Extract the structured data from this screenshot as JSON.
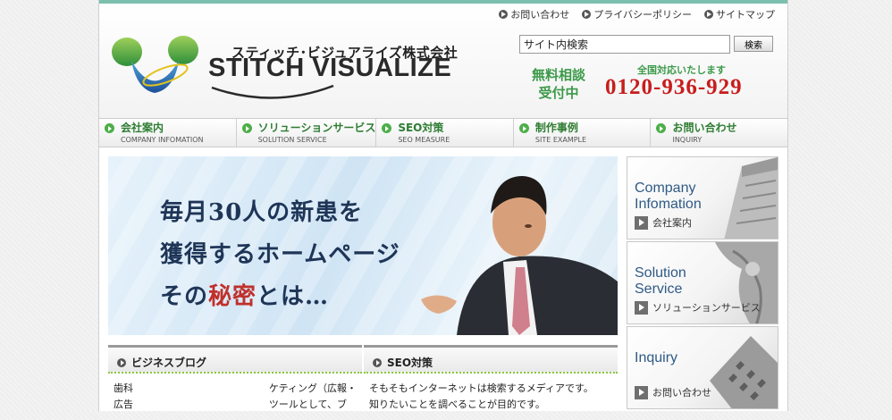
{
  "utility": [
    {
      "label": "お問い合わせ",
      "icon": "arrow-circle-icon"
    },
    {
      "label": "プライバシーポリシー",
      "icon": "arrow-circle-icon"
    },
    {
      "label": "サイトマップ",
      "icon": "arrow-circle-icon"
    }
  ],
  "brand": {
    "name_ja": "スティッチ･ビジュアライズ株式会社",
    "name_en": "STITCH VISUALIZE"
  },
  "search": {
    "value": "サイト内検索",
    "button_label": "検索"
  },
  "contact": {
    "consult_line1": "無料相談",
    "consult_line2": "受付中",
    "nationwide": "全国対応いたします",
    "phone": "0120-936-929"
  },
  "nav": [
    {
      "ja": "会社案内",
      "en": "COMPANY INFOMATION"
    },
    {
      "ja": "ソリューションサービス",
      "en": "SOLUTION SERVICE"
    },
    {
      "ja": "SEO対策",
      "en": "SEO MEASURE"
    },
    {
      "ja": "制作事例",
      "en": "SITE EXAMPLE"
    },
    {
      "ja": "お問い合わせ",
      "en": "INQUIRY"
    }
  ],
  "hero": {
    "line1": "毎月30人の新患を",
    "line2": "獲得するホームページ",
    "line3_prefix": "その",
    "line3_red": "秘密",
    "line3_suffix": "とは…"
  },
  "blog": {
    "title": "ビジネスブログ",
    "left_lines": [
      "歯科",
      "広告"
    ],
    "right_lines": [
      "ケティング（広報・",
      "ツールとして、ブ"
    ]
  },
  "seo": {
    "title": "SEO対策",
    "lines": [
      "そもそもインターネットは検索するメディアです。",
      "知りたいことを調べることが目的です。"
    ]
  },
  "side": [
    {
      "en": "Company\nInfomation",
      "ja": "会社案内"
    },
    {
      "en": "Solution\nService",
      "ja": "ソリューションサービス"
    },
    {
      "en": "Inquiry",
      "ja": "お問い合わせ"
    }
  ],
  "colors": {
    "accent_green": "#3c9a4a",
    "phone_red": "#c81d1d",
    "link_blue": "#2f5a86",
    "top_teal": "#7cbfae"
  }
}
